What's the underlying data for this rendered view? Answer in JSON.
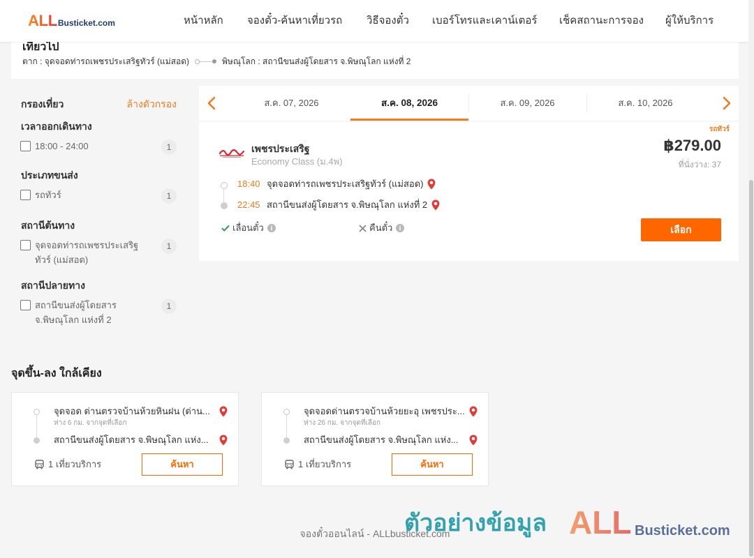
{
  "header": {
    "logo_all": "ALL",
    "logo_rest": "Busticket.com",
    "nav": [
      "หน้าหลัก",
      "จองตั๋ว-ค้นหาเที่ยวรถ",
      "วิธีจองตั๋ว",
      "เบอร์โทรและเคาน์เตอร์",
      "เช็คสถานะการจอง",
      "ผู้ให้บริการ"
    ]
  },
  "route": {
    "title": "เที่ยวไป",
    "origin": "ตาก : จุดจอดท่ารถเพชรประเสริฐทัวร์ (แม่สอด)",
    "destination": "พิษณุโลก : สถานีขนส่งผู้โดยสาร จ.พิษณุโลก แห่งที่ 2"
  },
  "filters": {
    "title": "กรองเที่ยว",
    "clear_label": "ล้างตัวกรอง",
    "groups": [
      {
        "title": "เวลาออกเดินทาง",
        "options": [
          {
            "label": "18:00 - 24:00",
            "count": 1,
            "checked": false
          }
        ]
      },
      {
        "title": "ประเภทขนส่ง",
        "options": [
          {
            "label": "รถทัวร์",
            "count": 1,
            "checked": false
          }
        ]
      },
      {
        "title": "สถานีต้นทาง",
        "options": [
          {
            "label": "จุดจอดท่ารถเพชรประเสริฐทัวร์ (แม่สอด)",
            "count": 1,
            "checked": false
          }
        ]
      },
      {
        "title": "สถานีปลายทาง",
        "options": [
          {
            "label": "สถานีขนส่งผู้โดยสาร จ.พิษณุโลก แห่งที่ 2",
            "count": 1,
            "checked": false
          }
        ]
      }
    ]
  },
  "dates": {
    "tabs": [
      "ส.ค. 07, 2026",
      "ส.ค. 08, 2026",
      "ส.ค. 09, 2026",
      "ส.ค. 10, 2026"
    ],
    "active_index": 1
  },
  "trip": {
    "transport_type": "รถทัวร์",
    "operator": "เพชรประเสริฐ",
    "class": "Economy Class (ม.4พ)",
    "price": "฿279.00",
    "seats_label": "ที่นั่งว่าง: 37",
    "stops": [
      {
        "time": "18:40",
        "station": "จุดจอดท่ารถเพชรประเสริฐทัวร์ (แม่สอด)"
      },
      {
        "time": "22:45",
        "station": "สถานีขนส่งผู้โดยสาร จ.พิษณุโลก แห่งที่ 2"
      }
    ],
    "features": [
      {
        "label": "เลื่อนตั๋ว",
        "available": true
      },
      {
        "label": "คืนตั๋ว",
        "available": false
      }
    ],
    "select_label": "เลือก"
  },
  "nearby": {
    "title": "จุดขึ้น-ลง ใกล้เคียง",
    "cards": [
      {
        "from": "จุดจอด ด่านตรวจบ้านห้วยหินฝน (ด่าน...",
        "distance": "ห่าง 6 กม. จากจุดที่เลือก",
        "to": "สถานีขนส่งผู้โดยสาร จ.พิษณุโลก แห่ง...",
        "trips": "1 เที่ยวบริการ",
        "search_label": "ค้นหา"
      },
      {
        "from": "จุดจอดด่านตรวจบ้านห้วยยะอุ เพชรประ...",
        "distance": "ห่าง 26 กม. จากจุดที่เลือก",
        "to": "สถานีขนส่งผู้โดยสาร จ.พิษณุโลก แห่ง...",
        "trips": "1 เที่ยวบริการ",
        "search_label": "ค้นหา"
      }
    ]
  },
  "footer": {
    "text": "จองตั๋วออนไลน์ - ALLbusticket.com"
  },
  "watermark": {
    "text": "ตัวอย่างข้อมูล",
    "logo_all": "ALL",
    "logo_rest": "Busticket.com"
  },
  "icons": {
    "date_prev": "chevron-left-icon",
    "date_next": "chevron-right-icon",
    "location": "map-pin-icon",
    "info": "info-icon",
    "available": "check-icon",
    "unavailable": "x-icon",
    "bus": "bus-icon"
  },
  "colors": {
    "accent": "#ff6600",
    "time": "#f07c20",
    "text": "#333333",
    "muted": "#9a9a9a",
    "check": "#2e9e4f",
    "pin": "#e53935",
    "watermark_teal": "#1f9aa8",
    "logo_navy": "#1d3c78",
    "page_bg": "#f5f5f5"
  }
}
